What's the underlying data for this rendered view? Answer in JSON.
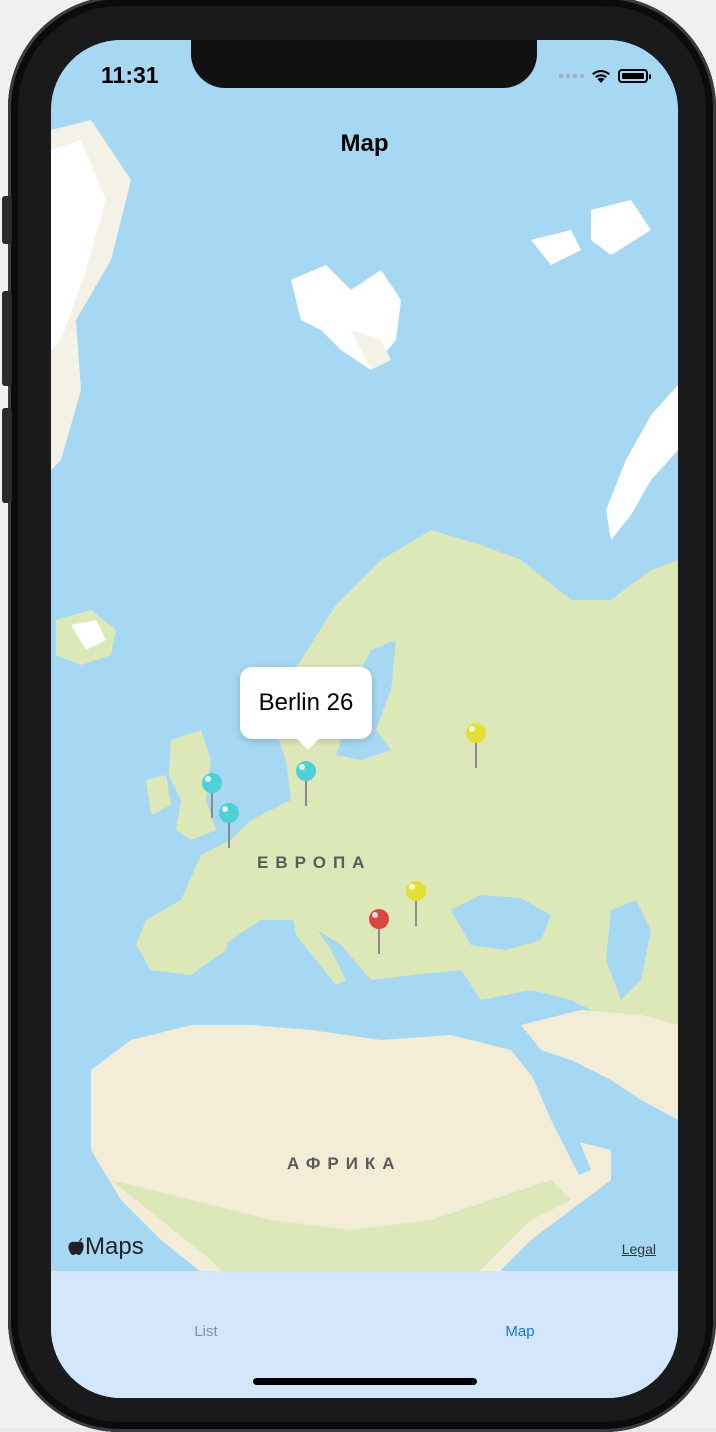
{
  "status_bar": {
    "time": "11:31"
  },
  "nav": {
    "title": "Map"
  },
  "map": {
    "callout": "Berlin 26",
    "region_labels": [
      "ЕВРОПА",
      "АФРИКА"
    ],
    "pins": [
      {
        "color": "#4fd0d6"
      },
      {
        "color": "#4fd0d6"
      },
      {
        "color": "#4fd0d6"
      },
      {
        "color": "#e2e034"
      },
      {
        "color": "#e2e034"
      },
      {
        "color": "#d9453f"
      }
    ],
    "attribution": "Maps",
    "legal": "Legal"
  },
  "tabs": [
    {
      "label": "List",
      "selected": false
    },
    {
      "label": "Map",
      "selected": true
    }
  ],
  "colors": {
    "accent": "#1a74e8",
    "water": "#a6d8f3",
    "land": "#dde8b8"
  }
}
